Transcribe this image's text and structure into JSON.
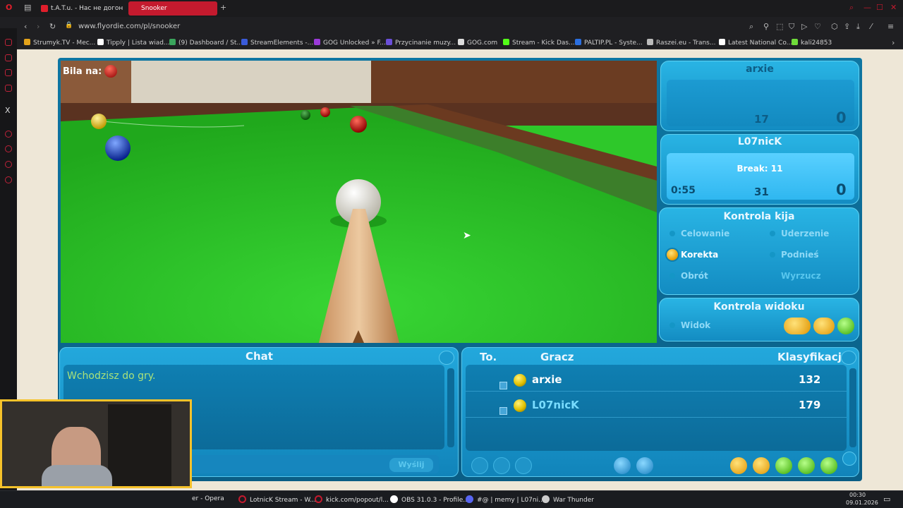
{
  "browser": {
    "tabs": [
      {
        "label": "t.A.T.u. - Нас не догон",
        "icon_color": "#e01e2b"
      },
      {
        "label": "Snooker",
        "icon_color": "#c41a2e"
      }
    ],
    "new_tab_label": "+",
    "url": "www.flyordie.com/pl/snooker",
    "bookmarks": [
      {
        "label": "Strumyk.TV - Mec...",
        "color": "#e3a21a"
      },
      {
        "label": "Tipply | Lista wiad...",
        "color": "#ffffff"
      },
      {
        "label": "(9) Dashboard / St...",
        "color": "#3aa55c"
      },
      {
        "label": "StreamElements -...",
        "color": "#3a5bd9"
      },
      {
        "label": "GOG Unlocked » F...",
        "color": "#9b3ad9"
      },
      {
        "label": "Przycinanie muzy...",
        "color": "#6b4fd9"
      },
      {
        "label": "GOG.com",
        "color": "#dddddd"
      },
      {
        "label": "Stream - Kick Das...",
        "color": "#53fc18"
      },
      {
        "label": "PALTIP.PL - Syste...",
        "color": "#2b6fe0"
      },
      {
        "label": "Raszei.eu - Trans...",
        "color": "#bbbbbb"
      },
      {
        "label": "Latest National Co...",
        "color": "#ffffff"
      },
      {
        "label": "kali24853",
        "color": "#6fdc3a"
      }
    ]
  },
  "game": {
    "ball_on_label": "Bila na:",
    "player1": {
      "name": "arxie",
      "score_left": "17",
      "score_right": "0"
    },
    "player2": {
      "name": "L07nicK",
      "break_text": "Break: 11",
      "timer": "0:55",
      "score_left": "31",
      "score_right": "0"
    },
    "cue_control": {
      "title": "Kontrola kija",
      "items": [
        {
          "label": "Celowanie",
          "active": false
        },
        {
          "label": "Uderzenie",
          "active": false
        },
        {
          "label": "Korekta",
          "active": true
        },
        {
          "label": "Podnieś",
          "active": false
        },
        {
          "label": "Obrót",
          "active": false
        },
        {
          "label": "Wyrzucz",
          "active": false
        }
      ]
    },
    "view_control": {
      "title": "Kontrola widoku",
      "item": "Widok"
    },
    "chat": {
      "title": "Chat",
      "message": "Wchodzisz do gry.",
      "send_label": "Wyślij"
    },
    "players_list": {
      "col_table": "To.",
      "col_player": "Gracz",
      "col_rank": "Klasyfikacja",
      "rows": [
        {
          "name": "arxie",
          "rating": "132"
        },
        {
          "name": "L07nicK",
          "rating": "179"
        }
      ]
    }
  },
  "taskbar": {
    "items": [
      {
        "label": "er - Opera",
        "color": "#c41a2e"
      },
      {
        "label": "LotnicK Stream - W...",
        "color": "#c41a2e"
      },
      {
        "label": "kick.com/popout/l...",
        "color": "#c41a2e"
      },
      {
        "label": "OBS 31.0.3 - Profile...",
        "color": "#ffffff"
      },
      {
        "label": "#@ | memy | L07ni...",
        "color": "#5865f2"
      },
      {
        "label": "War Thunder",
        "color": "#cccccc"
      }
    ],
    "time": "00:30",
    "date": "09.01.2026"
  }
}
